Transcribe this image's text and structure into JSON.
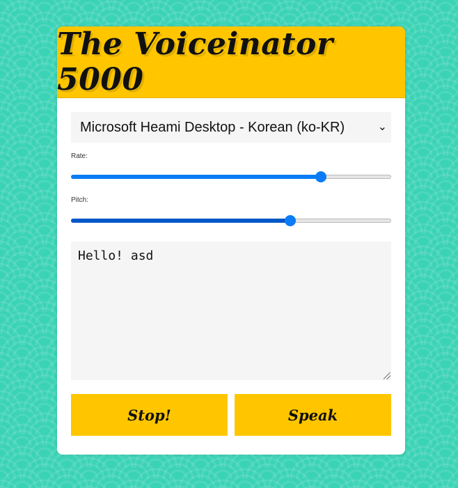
{
  "app": {
    "title": "The Voiceinator 5000"
  },
  "voice_select": {
    "selected": "Microsoft Heami Desktop - Korean (ko-KR)"
  },
  "rate": {
    "label": "Rate:",
    "value_fraction": 0.78
  },
  "pitch": {
    "label": "Pitch:",
    "value_fraction": 0.685
  },
  "message": {
    "value": "Hello! asd"
  },
  "buttons": {
    "stop_label": "Stop!",
    "speak_label": "Speak"
  },
  "colors": {
    "background": "#3bd3b5",
    "accent": "#ffc600",
    "slider": "#0b7cf5"
  },
  "icons": {
    "select_arrow": "chevron-down-icon"
  }
}
